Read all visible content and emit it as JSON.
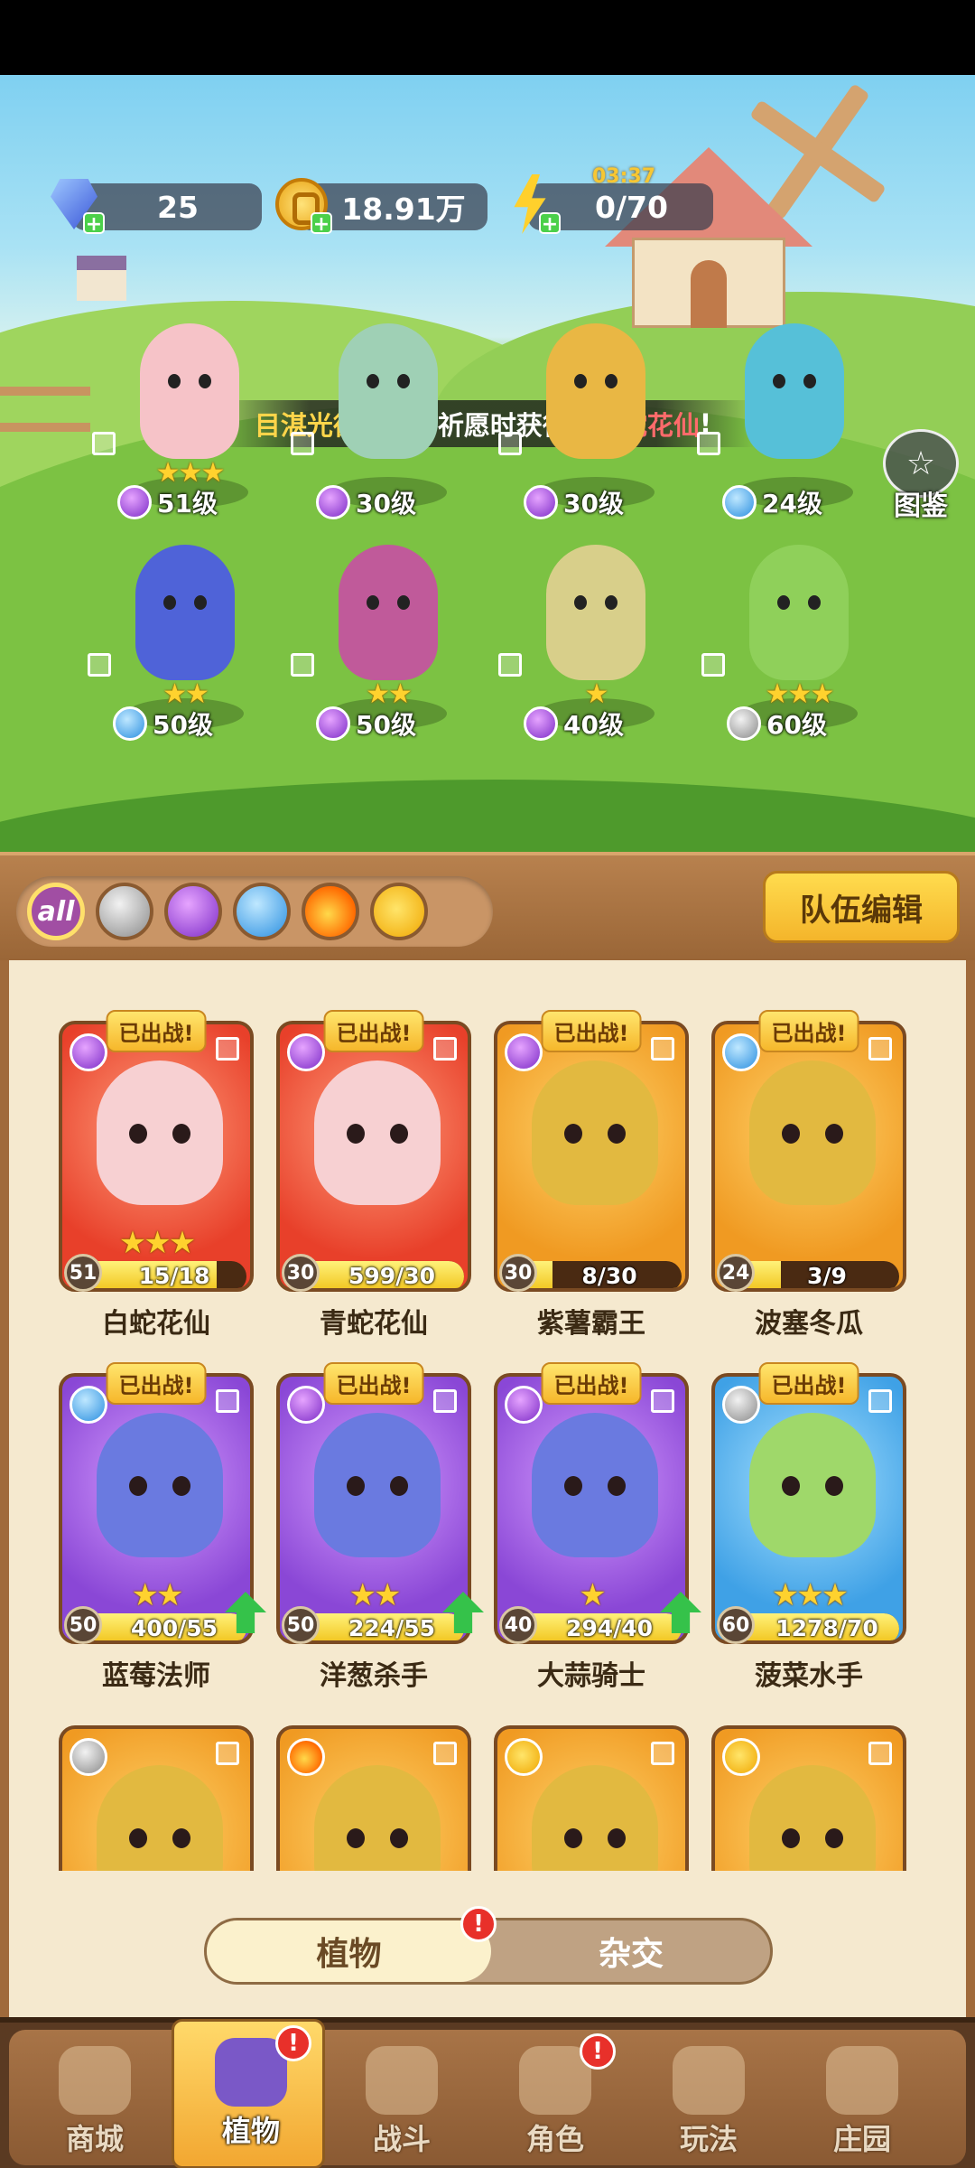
{
  "resources": {
    "gems": "25",
    "gold": "18.91万",
    "energy": "0/70",
    "energy_timer": "03:37"
  },
  "banner": {
    "player": "目湛光德",
    "text": "在限时祈愿时获得了",
    "plant": "青蛇花仙",
    "end": "!"
  },
  "codex_label": "图鉴",
  "field_plants": [
    {
      "level": "51级",
      "stars": "★★★",
      "element": "purple"
    },
    {
      "level": "30级",
      "stars": "",
      "element": "purple"
    },
    {
      "level": "30级",
      "stars": "",
      "element": "purple"
    },
    {
      "level": "24级",
      "stars": "",
      "element": "blue"
    },
    {
      "level": "50级",
      "stars": "★★",
      "element": "blue"
    },
    {
      "level": "50级",
      "stars": "★★",
      "element": "purple"
    },
    {
      "level": "40级",
      "stars": "★",
      "element": "purple"
    },
    {
      "level": "60级",
      "stars": "★★★",
      "element": "sword"
    }
  ],
  "filters": {
    "all_label": "all",
    "elements": [
      "sword",
      "purple",
      "blue",
      "fire",
      "bolt"
    ]
  },
  "team_edit_label": "队伍编辑",
  "deployed_label": "已出战!",
  "cards": [
    {
      "name": "白蛇花仙",
      "level": "51",
      "progress": "15/18",
      "fill": 0.83,
      "stars": "★★★",
      "bg": "red",
      "element": "purple",
      "deployed": true,
      "upgrade": false
    },
    {
      "name": "青蛇花仙",
      "level": "30",
      "progress": "599/30",
      "fill": 1.0,
      "stars": "",
      "bg": "red",
      "element": "purple",
      "deployed": true,
      "upgrade": false
    },
    {
      "name": "紫薯霸王",
      "level": "30",
      "progress": "8/30",
      "fill": 0.27,
      "stars": "",
      "bg": "orange",
      "element": "purple",
      "deployed": true,
      "upgrade": false
    },
    {
      "name": "波塞冬瓜",
      "level": "24",
      "progress": "3/9",
      "fill": 0.33,
      "stars": "",
      "bg": "orange",
      "element": "blue",
      "deployed": true,
      "upgrade": false
    },
    {
      "name": "蓝莓法师",
      "level": "50",
      "progress": "400/55",
      "fill": 1.0,
      "stars": "★★",
      "bg": "purple",
      "element": "blue",
      "deployed": true,
      "upgrade": true
    },
    {
      "name": "洋葱杀手",
      "level": "50",
      "progress": "224/55",
      "fill": 1.0,
      "stars": "★★",
      "bg": "purple",
      "element": "purple",
      "deployed": true,
      "upgrade": true
    },
    {
      "name": "大蒜骑士",
      "level": "40",
      "progress": "294/40",
      "fill": 1.0,
      "stars": "★",
      "bg": "purple",
      "element": "purple",
      "deployed": true,
      "upgrade": true
    },
    {
      "name": "菠菜水手",
      "level": "60",
      "progress": "1278/70",
      "fill": 1.0,
      "stars": "★★★",
      "bg": "blue",
      "element": "sword",
      "deployed": true,
      "upgrade": false
    },
    {
      "name": "",
      "level": "",
      "progress": "",
      "fill": 0,
      "stars": "",
      "bg": "orange",
      "element": "sword",
      "deployed": false,
      "upgrade": false
    },
    {
      "name": "",
      "level": "",
      "progress": "",
      "fill": 0,
      "stars": "",
      "bg": "orange",
      "element": "fire",
      "deployed": false,
      "upgrade": false
    },
    {
      "name": "",
      "level": "",
      "progress": "",
      "fill": 0,
      "stars": "",
      "bg": "orange",
      "element": "bolt",
      "deployed": false,
      "upgrade": false
    },
    {
      "name": "",
      "level": "",
      "progress": "",
      "fill": 0,
      "stars": "",
      "bg": "orange",
      "element": "bolt",
      "deployed": false,
      "upgrade": false
    }
  ],
  "toggle": {
    "plants": "植物",
    "hybrid": "杂交",
    "badge": "!"
  },
  "nav": [
    {
      "label": "商城",
      "icon": "shop-icon",
      "badge": ""
    },
    {
      "label": "植物",
      "icon": "plants-icon",
      "badge": "!"
    },
    {
      "label": "战斗",
      "icon": "battle-icon",
      "badge": ""
    },
    {
      "label": "角色",
      "icon": "character-icon",
      "badge": "!"
    },
    {
      "label": "玩法",
      "icon": "gameplay-icon",
      "badge": ""
    },
    {
      "label": "庄园",
      "icon": "manor-icon",
      "badge": ""
    }
  ],
  "nav_active": 1
}
